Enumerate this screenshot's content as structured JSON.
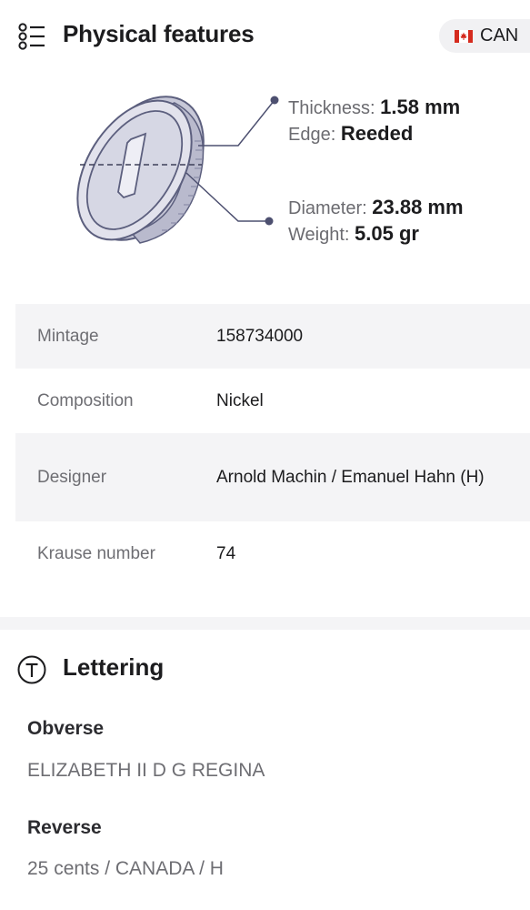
{
  "header": {
    "title": "Physical features",
    "country_code": "CAN",
    "country_flag_icon": "canada-flag-icon",
    "list_icon": "list-icon"
  },
  "specs": {
    "thickness_label": "Thickness:",
    "thickness_value": "1.58 mm",
    "edge_label": "Edge:",
    "edge_value": "Reeded",
    "diameter_label": "Diameter:",
    "diameter_value": "23.88 mm",
    "weight_label": "Weight:",
    "weight_value": "5.05 gr"
  },
  "details": [
    {
      "label": "Mintage",
      "value": "158734000"
    },
    {
      "label": "Composition",
      "value": "Nickel"
    },
    {
      "label": "Designer",
      "value": "Arnold Machin / Emanuel Hahn (H)"
    },
    {
      "label": "Krause number",
      "value": "74"
    }
  ],
  "lettering": {
    "title": "Lettering",
    "icon": "text-t-icon",
    "obverse_label": "Obverse",
    "obverse_value": "ELIZABETH II D G REGINA",
    "reverse_label": "Reverse",
    "reverse_value": "25 cents / CANADA / H"
  },
  "colors": {
    "accent": "#d52b1e",
    "shaded_row": "#f4f4f6",
    "coin_fill": "#dcdce8",
    "coin_stroke": "#5c5f7e"
  }
}
